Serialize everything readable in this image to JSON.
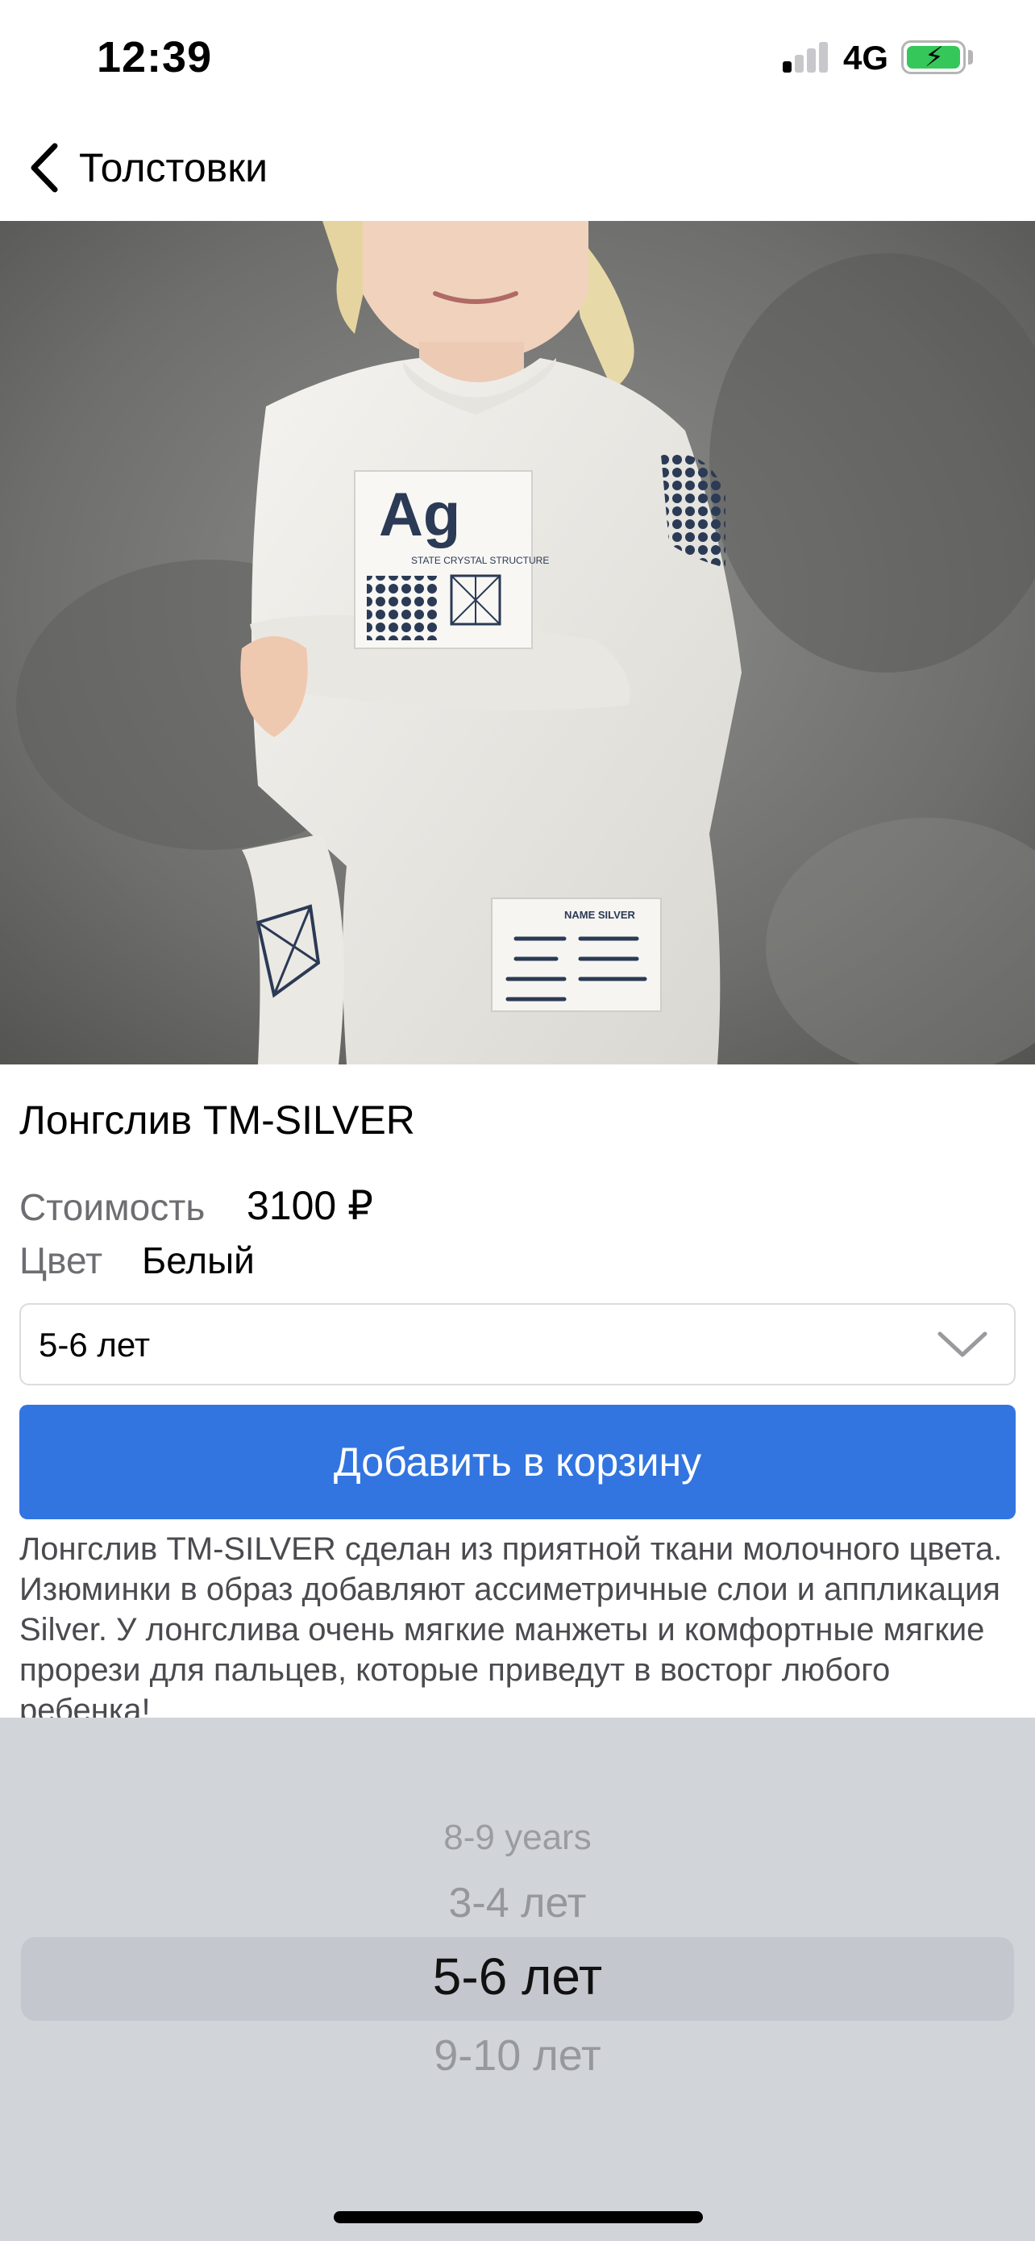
{
  "status_bar": {
    "time": "12:39",
    "network": "4G",
    "signal_bars_on": 1,
    "signal_bars_total": 4,
    "battery_charging": true
  },
  "nav": {
    "back_label": "Толстовки"
  },
  "product": {
    "title": "Лонгслив TM-SILVER",
    "price_label": "Стоимость",
    "price_value": "3100 ₽",
    "color_label": "Цвет",
    "color_value": "Белый",
    "selected_size": "5-6 лет",
    "add_to_cart_label": "Добавить в корзину",
    "description": "Лонгслив TM-SILVER сделан из приятной ткани молочного цвета. Изюминки в образ добавляют ассиметричные слои и аппликация Silver. У лонгслива очень мягкие манжеты и комфортные мягкие прорези для пальцев, которые приведут в восторг любого ребенка!"
  },
  "image_print": {
    "logo": "Ag",
    "structure": "STATE CRYSTAL STRUCTURE",
    "patch_name": "NAME SILVER"
  },
  "picker": {
    "options": [
      "8-9 years",
      "3-4 лет",
      "5-6 лет",
      "9-10 лет"
    ],
    "selected": "5-6 лет"
  },
  "colors": {
    "accent": "#3275e0",
    "picker_bg": "#d1d4d9",
    "battery": "#35c759"
  }
}
